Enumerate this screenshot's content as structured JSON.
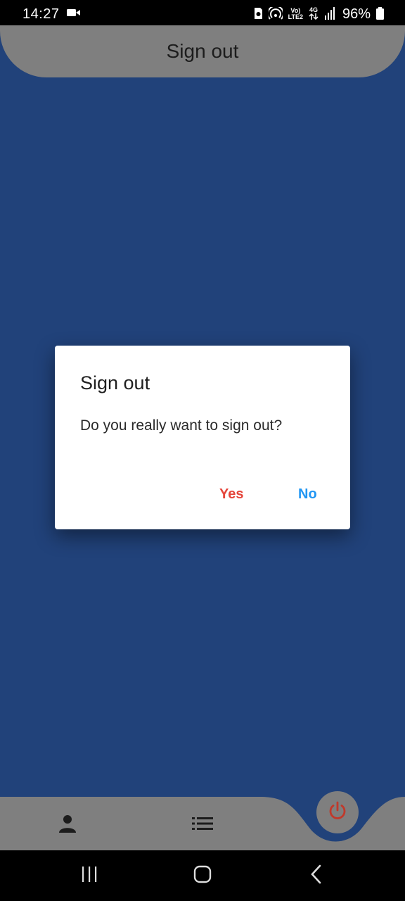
{
  "status_bar": {
    "time": "14:27",
    "battery_text": "96%",
    "volte_label_top": "Vo)",
    "volte_label_bottom": "LTE2",
    "network_label": "4G",
    "icons": [
      "video-camera-icon",
      "sim-icon",
      "hotspot-icon",
      "data-arrows-icon",
      "signal-icon",
      "battery-icon"
    ]
  },
  "header": {
    "title": "Sign out"
  },
  "dialog": {
    "title": "Sign out",
    "message": "Do you really want to sign out?",
    "yes_label": "Yes",
    "no_label": "No"
  },
  "bottom_nav": {
    "items": [
      "profile-icon",
      "list-icon",
      "power-icon"
    ]
  },
  "system_nav": {
    "buttons": [
      "recent-apps",
      "home",
      "back"
    ]
  },
  "colors": {
    "background": "#21427a",
    "header": "#7f7f7f",
    "yes": "#e5453a",
    "no": "#2196f3",
    "power": "#c0392b"
  }
}
